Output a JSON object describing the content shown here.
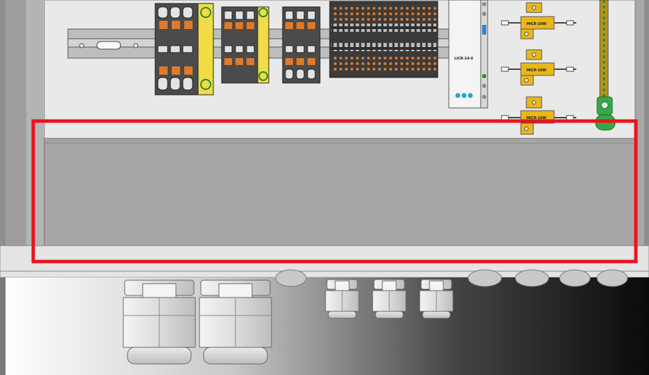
{
  "drawing": {
    "terminal_labels": {
      "relay_module": "LICR-24-0",
      "resistor_1": "MICR-10W",
      "resistor_2": "MICR-10W",
      "resistor_3": "MICR-10W"
    },
    "highlight": {
      "color": "#e8141c",
      "meaning": "red outline box"
    },
    "colors": {
      "panel_light": "#e8e8e8",
      "panel_grey": "#a6a6a6",
      "terminal_dark": "#4b4b4b",
      "terminal_orange": "#e07a2a",
      "terminal_yellow": "#f2dc45",
      "resistor_gold": "#e8b81a",
      "bus_bar_green": "#3aa64a"
    }
  }
}
